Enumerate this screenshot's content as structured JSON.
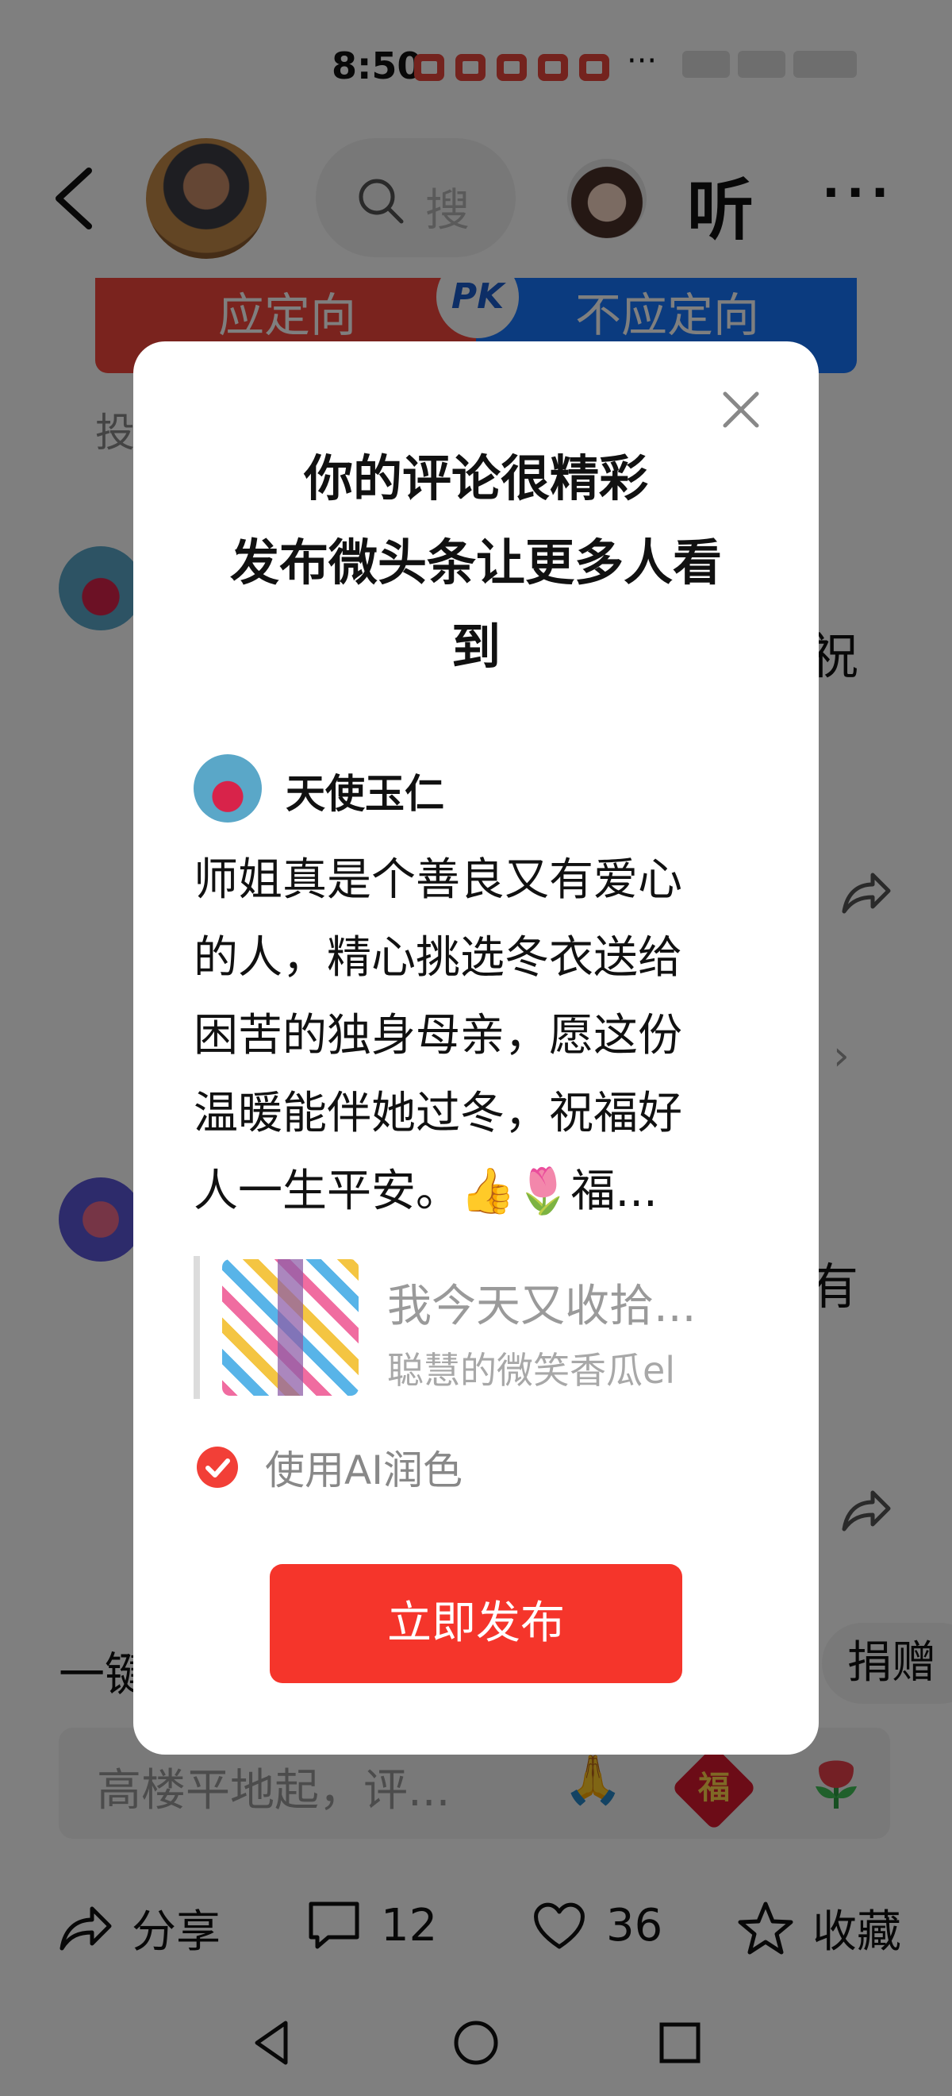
{
  "status_bar": {
    "time": "8:50",
    "more": "···"
  },
  "top_nav": {
    "search_hint": "搜",
    "listen_label": "听",
    "more_label": "···"
  },
  "pk_vote": {
    "left_label": "应定向",
    "badge": "PK",
    "right_label": "不应定向",
    "hint": "投"
  },
  "background_comments": {
    "fragment_1": "祝",
    "fragment_2": "有",
    "fragment_3": "一键",
    "donate_label": "捐赠"
  },
  "comment_input": {
    "placeholder": "高楼平地起，评..."
  },
  "bottom_actions": {
    "share_label": "分享",
    "comment_count": "12",
    "like_count": "36",
    "favorite_label": "收藏"
  },
  "modal": {
    "title_line_1": "你的评论很精彩",
    "title_line_2": "发布微头条让更多人看",
    "title_line_3": "到",
    "author_name": "天使玉仁",
    "comment_lines": [
      "师姐真是个善良又有爱心",
      "的人，精心挑选冬衣送给",
      "困苦的独身母亲，愿这份",
      "温暖能伴她过冬，祝福好",
      "人一生平安。👍🌷福..."
    ],
    "ref_title": "我今天又收拾...",
    "ref_author": "聪慧的微笑香瓜el",
    "ai_polish_label": "使用AI润色",
    "ai_polish_checked": true,
    "publish_button": "立即发布"
  },
  "colors": {
    "brand_red": "#f5352b",
    "pk_red": "#f4473d",
    "pk_blue": "#1777ff"
  }
}
